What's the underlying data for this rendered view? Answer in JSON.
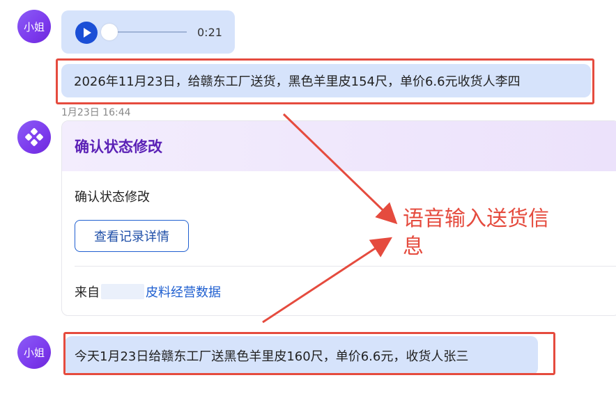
{
  "messages": {
    "user_avatar_label": "小姐",
    "voice_duration": "0:21",
    "voice_progress": 0.0,
    "transcription": "2026年11月23日，给赣东工厂送货，黑色羊里皮154尺，单价6.6元收货人李四",
    "timestamp": "1月23日 16:44",
    "bottom_message": "今天1月23日给赣东工厂送黑色羊里皮160尺，单价6.6元，收货人张三"
  },
  "card": {
    "title": "确认状态修改",
    "body": "确认状态修改",
    "button_label": "查看记录详情",
    "source_prefix": "来自",
    "source_link": "皮料经营数据"
  },
  "annotation": {
    "text": "语音输入送货信息",
    "color": "#e54b3e"
  },
  "colors": {
    "bubble": "#d6e3fb",
    "avatar": "#7c3aed",
    "accent_blue": "#1f5fd0",
    "card_title": "#5b21b6"
  }
}
